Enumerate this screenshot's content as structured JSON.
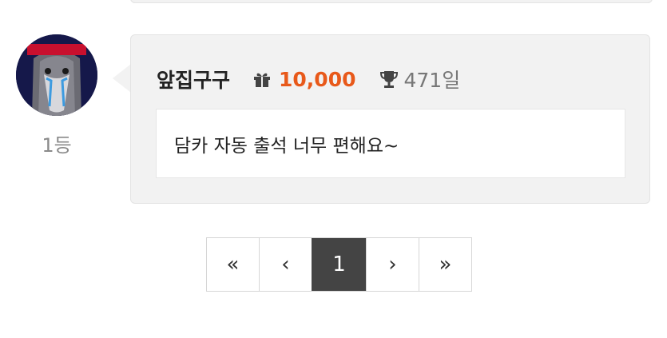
{
  "colors": {
    "accent": "#e8591a",
    "active_page_bg": "#444444",
    "bubble_bg": "#f2f2f2"
  },
  "comment": {
    "rank_label": "1등",
    "avatar_banner_text": "단결&투쟁",
    "username": "앞집구구",
    "points_icon": "gift-icon",
    "points": "10,000",
    "days_icon": "trophy-icon",
    "days": "471일",
    "text": "담카 자동 출석 너무 편해요~"
  },
  "pagination": {
    "first_label": "«",
    "prev_label": "‹",
    "current_page": "1",
    "next_label": "›",
    "last_label": "»"
  }
}
